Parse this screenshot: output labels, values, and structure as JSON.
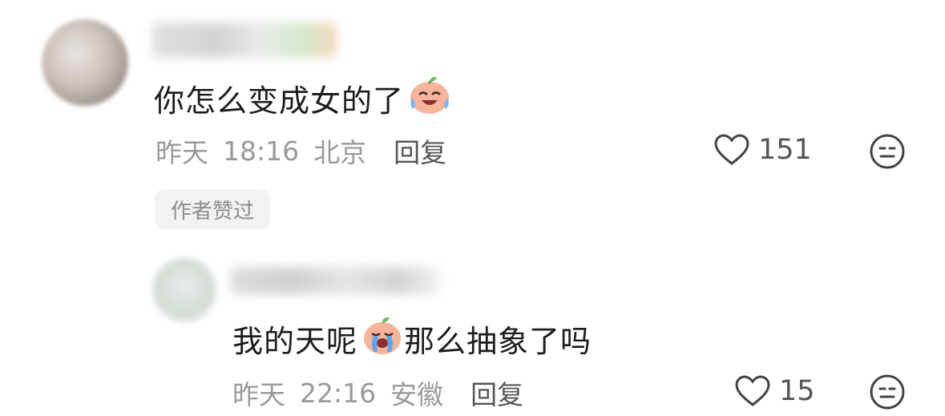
{
  "comments": [
    {
      "text_before": "你怎么变成女的了",
      "text_after": "",
      "emoji": "laugh-cry-emoji",
      "date": "昨天",
      "time": "18:16",
      "location": "北京",
      "reply_label": "回复",
      "likes": "151",
      "badge": "作者赞过"
    },
    {
      "text_before": "我的天呢",
      "text_after": "那么抽象了吗",
      "emoji": "crying-emoji",
      "date": "昨天",
      "time": "22:16",
      "location": "安徽",
      "reply_label": "回复",
      "likes": "15"
    }
  ]
}
